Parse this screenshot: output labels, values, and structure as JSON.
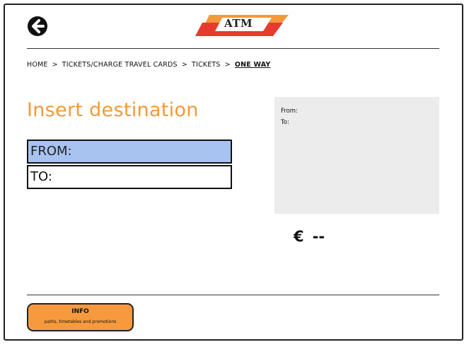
{
  "header": {
    "logo_text": "ATM",
    "back_icon": "arrow-left-circle-icon",
    "logo_colors": {
      "red": "#e63b2e",
      "orange": "#f4983a"
    }
  },
  "breadcrumb": {
    "items": [
      "HOME",
      "TICKETS/CHARGE TRAVEL CARDS",
      "TICKETS",
      "ONE WAY"
    ],
    "separator": ">"
  },
  "main": {
    "title": "Insert destination",
    "title_color": "#f4983a",
    "from_field": "FROM:",
    "to_field": "TO:",
    "active_field_color": "#a8c3f0"
  },
  "summary": {
    "from_label": "From:",
    "to_label": "To:"
  },
  "price": {
    "currency": "€",
    "value": "--"
  },
  "info_button": {
    "title": "INFO",
    "subtitle": "paths, timetables and promotions",
    "color": "#f79a3d"
  }
}
